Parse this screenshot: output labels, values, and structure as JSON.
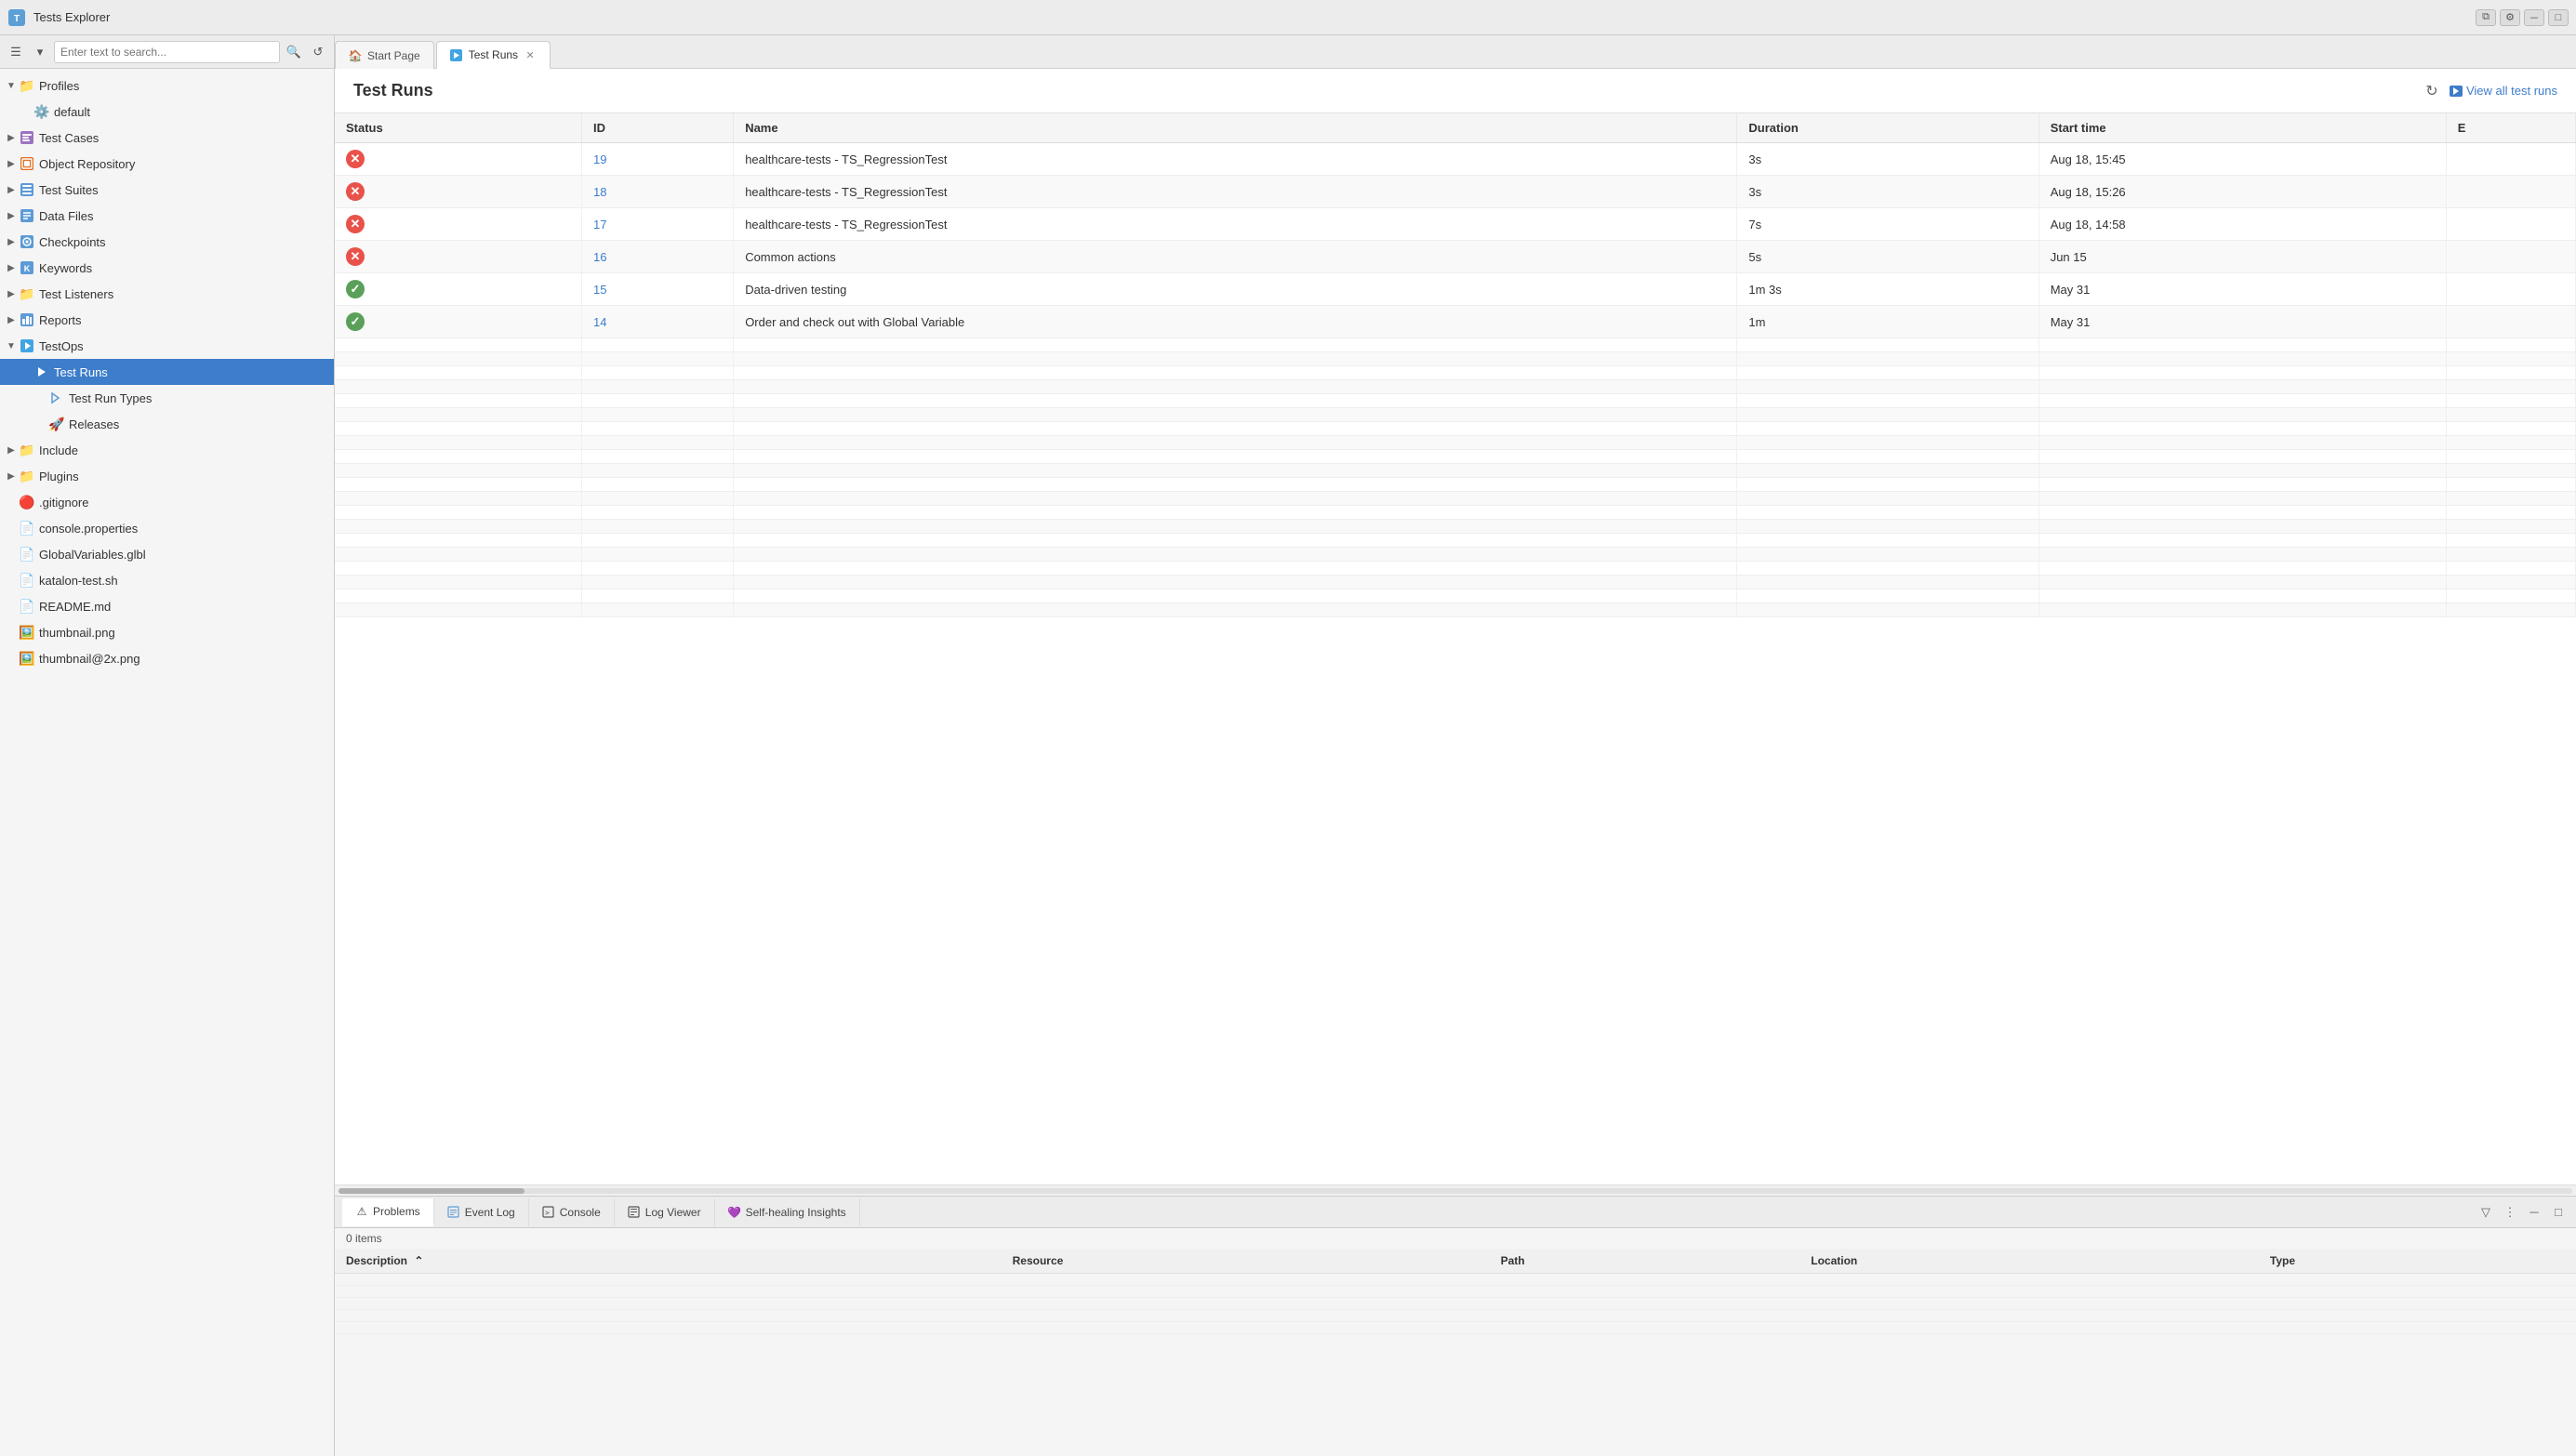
{
  "window": {
    "title": "Tests Explorer",
    "title_icon": "🧪"
  },
  "title_bar": {
    "controls": [
      "minimize",
      "restore",
      "close"
    ]
  },
  "sidebar": {
    "search_placeholder": "Enter text to search...",
    "tree": [
      {
        "id": "profiles",
        "label": "Profiles",
        "level": 0,
        "icon": "folder",
        "arrow": "open",
        "icon_type": "folder-icon"
      },
      {
        "id": "default",
        "label": "default",
        "level": 1,
        "icon": "⚙️",
        "arrow": "leaf",
        "icon_type": "default-icon"
      },
      {
        "id": "test-cases",
        "label": "Test Cases",
        "level": 0,
        "icon": "🗂️",
        "arrow": "closed",
        "icon_type": "testcase-icon"
      },
      {
        "id": "object-repository",
        "label": "Object Repository",
        "level": 0,
        "icon": "📦",
        "arrow": "closed",
        "icon_type": "objrepo-icon"
      },
      {
        "id": "test-suites",
        "label": "Test Suites",
        "level": 0,
        "icon": "📋",
        "arrow": "closed",
        "icon_type": "testsuite-icon"
      },
      {
        "id": "data-files",
        "label": "Data Files",
        "level": 0,
        "icon": "📄",
        "arrow": "closed",
        "icon_type": "datafile-icon"
      },
      {
        "id": "checkpoints",
        "label": "Checkpoints",
        "level": 0,
        "icon": "📷",
        "arrow": "closed",
        "icon_type": "checkpoint-icon"
      },
      {
        "id": "keywords",
        "label": "Keywords",
        "level": 0,
        "icon": "🔑",
        "arrow": "closed",
        "icon_type": "keyword-icon"
      },
      {
        "id": "test-listeners",
        "label": "Test Listeners",
        "level": 0,
        "icon": "📁",
        "arrow": "closed",
        "icon_type": "listener-icon"
      },
      {
        "id": "reports",
        "label": "Reports",
        "level": 0,
        "icon": "📊",
        "arrow": "closed",
        "icon_type": "reports-icon"
      },
      {
        "id": "testops",
        "label": "TestOps",
        "level": 0,
        "icon": "🔷",
        "arrow": "open",
        "icon_type": "testops-icon"
      },
      {
        "id": "test-runs",
        "label": "Test Runs",
        "level": 1,
        "icon": "▶",
        "arrow": "leaf",
        "icon_type": "testrun-icon",
        "selected": true
      },
      {
        "id": "test-run-types",
        "label": "Test Run Types",
        "level": 2,
        "icon": "▷",
        "arrow": "leaf",
        "icon_type": "testruntypes-icon"
      },
      {
        "id": "releases",
        "label": "Releases",
        "level": 2,
        "icon": "🚀",
        "arrow": "leaf",
        "icon_type": "releases-icon"
      },
      {
        "id": "include",
        "label": "Include",
        "level": 0,
        "icon": "📁",
        "arrow": "closed",
        "icon_type": "include-icon"
      },
      {
        "id": "plugins",
        "label": "Plugins",
        "level": 0,
        "icon": "📁",
        "arrow": "closed",
        "icon_type": "plugins-icon"
      },
      {
        "id": "gitignore",
        "label": ".gitignore",
        "level": 0,
        "icon": "🔴",
        "arrow": "leaf",
        "icon_type": "gitignore-icon"
      },
      {
        "id": "console-properties",
        "label": "console.properties",
        "level": 0,
        "icon": "📄",
        "arrow": "leaf",
        "icon_type": "file-icon"
      },
      {
        "id": "globalvariables",
        "label": "GlobalVariables.glbl",
        "level": 0,
        "icon": "📄",
        "arrow": "leaf",
        "icon_type": "file-icon"
      },
      {
        "id": "katalon-test",
        "label": "katalon-test.sh",
        "level": 0,
        "icon": "📄",
        "arrow": "leaf",
        "icon_type": "file-icon"
      },
      {
        "id": "readme",
        "label": "README.md",
        "level": 0,
        "icon": "📄",
        "arrow": "leaf",
        "icon_type": "file-icon"
      },
      {
        "id": "thumbnail",
        "label": "thumbnail.png",
        "level": 0,
        "icon": "🖼️",
        "arrow": "leaf",
        "icon_type": "file-icon"
      },
      {
        "id": "thumbnail2x",
        "label": "thumbnail@2x.png",
        "level": 0,
        "icon": "🖼️",
        "arrow": "leaf",
        "icon_type": "file-icon"
      }
    ]
  },
  "tabs": [
    {
      "id": "start-page",
      "label": "Start Page",
      "icon": "🏠",
      "active": false,
      "closeable": false
    },
    {
      "id": "test-runs-tab",
      "label": "Test Runs",
      "icon": "▶",
      "active": true,
      "closeable": true
    }
  ],
  "main_panel": {
    "title": "Test Runs",
    "view_all_label": "View all test runs",
    "columns": [
      "Status",
      "ID",
      "Name",
      "Duration",
      "Start time",
      "E"
    ],
    "rows": [
      {
        "status": "fail",
        "id": "19",
        "name": "healthcare-tests - TS_RegressionTest",
        "duration": "3s",
        "start_time": "Aug 18, 15:45"
      },
      {
        "status": "fail",
        "id": "18",
        "name": "healthcare-tests - TS_RegressionTest",
        "duration": "3s",
        "start_time": "Aug 18, 15:26"
      },
      {
        "status": "fail",
        "id": "17",
        "name": "healthcare-tests - TS_RegressionTest",
        "duration": "7s",
        "start_time": "Aug 18, 14:58"
      },
      {
        "status": "fail",
        "id": "16",
        "name": "Common actions",
        "duration": "5s",
        "start_time": "Jun 15"
      },
      {
        "status": "pass",
        "id": "15",
        "name": "Data-driven testing",
        "duration": "1m 3s",
        "start_time": "May 31"
      },
      {
        "status": "pass",
        "id": "14",
        "name": "Order and check out with Global Variable",
        "duration": "1m",
        "start_time": "May 31"
      }
    ]
  },
  "bottom_panel": {
    "tabs": [
      {
        "id": "problems",
        "label": "Problems",
        "icon": "⚠",
        "active": true
      },
      {
        "id": "event-log",
        "label": "Event Log",
        "icon": "📋",
        "active": false
      },
      {
        "id": "console",
        "label": "Console",
        "icon": "🖥",
        "active": false
      },
      {
        "id": "log-viewer",
        "label": "Log Viewer",
        "icon": "📄",
        "active": false
      },
      {
        "id": "self-healing",
        "label": "Self-healing Insights",
        "icon": "💜",
        "active": false
      }
    ],
    "status": "0 items",
    "columns": [
      "Description",
      "Resource",
      "Path",
      "Location",
      "Type"
    ]
  }
}
